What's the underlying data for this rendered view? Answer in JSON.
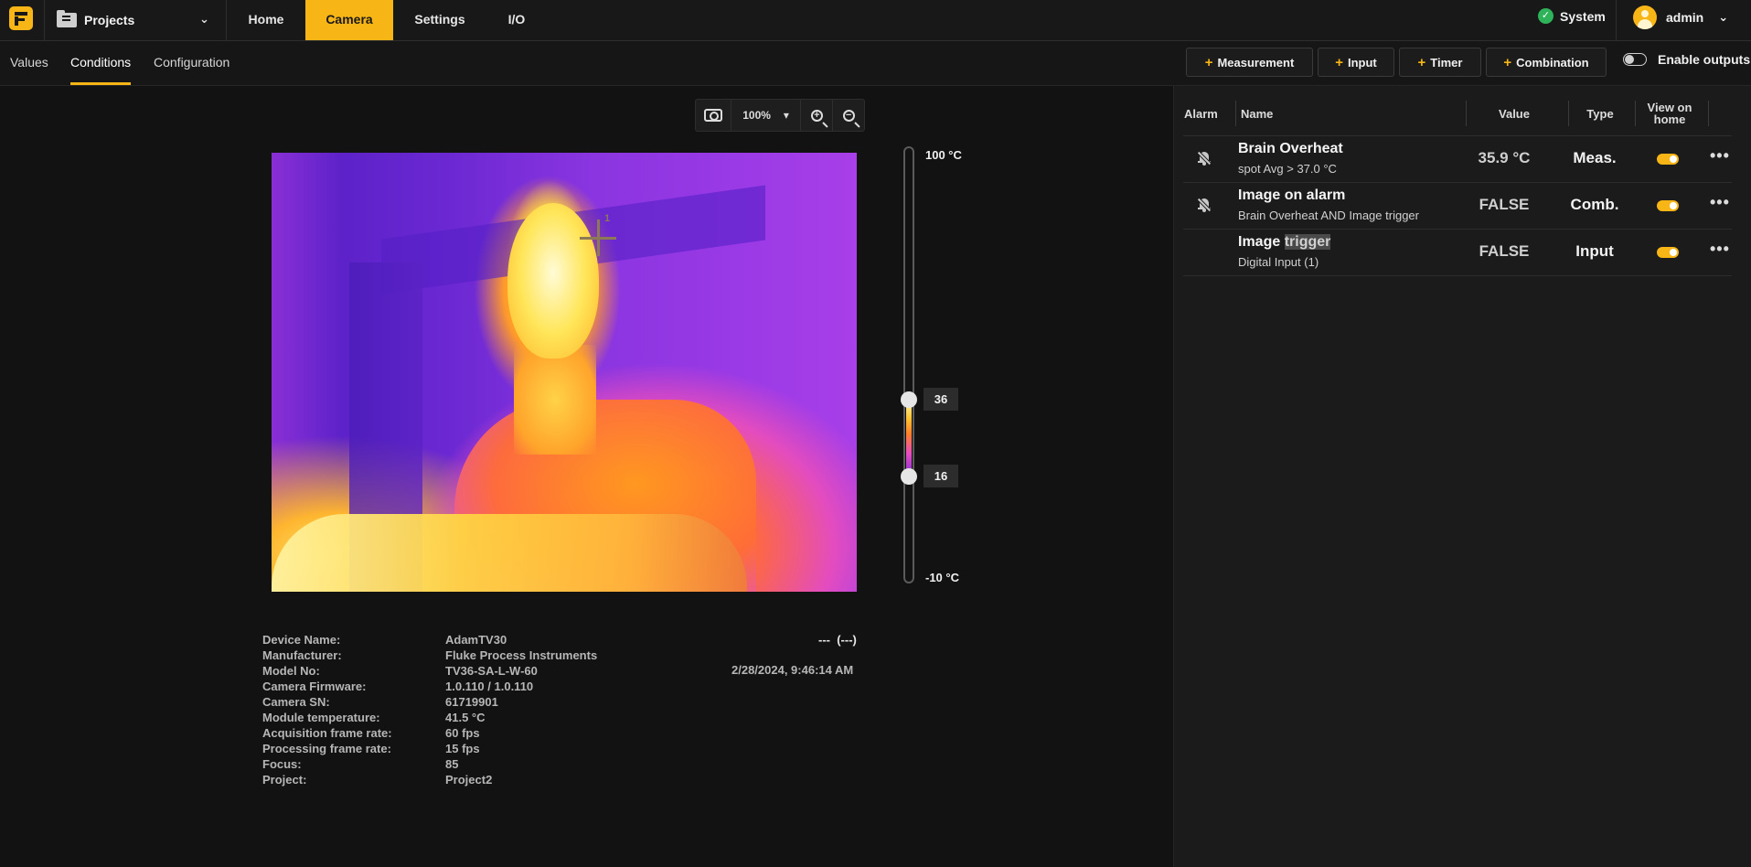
{
  "topnav": {
    "projects_label": "Projects",
    "tabs": [
      {
        "label": "Home"
      },
      {
        "label": "Camera"
      },
      {
        "label": "Settings"
      },
      {
        "label": "I/O"
      }
    ],
    "active_tab": "Camera",
    "system_label": "System",
    "user_label": "admin"
  },
  "subnav": {
    "tabs": [
      {
        "label": "Values"
      },
      {
        "label": "Conditions"
      },
      {
        "label": "Configuration"
      }
    ],
    "active_tab": "Conditions",
    "add_buttons": [
      {
        "label": "Measurement"
      },
      {
        "label": "Input"
      },
      {
        "label": "Timer"
      },
      {
        "label": "Combination"
      }
    ],
    "plus_glyph": "+",
    "enable_outputs_label": "Enable outputs",
    "enable_outputs_on": false
  },
  "toolbar": {
    "zoom_level": "100%",
    "zoom_caret": "▾",
    "icons": [
      "snapshot-camera-icon",
      "zoom-in-icon",
      "zoom-out-icon"
    ]
  },
  "thermal": {
    "crosshair_label": "1",
    "palette": "ironbow"
  },
  "scale": {
    "max_label": "100 °C",
    "min_label": "-10 °C",
    "upper_value": "36",
    "lower_value": "16"
  },
  "device_info": {
    "rows": [
      {
        "key": "Device Name:",
        "value": "AdamTV30"
      },
      {
        "key": "Manufacturer:",
        "value": "Fluke Process Instruments"
      },
      {
        "key": "Model No:",
        "value": "TV36-SA-L-W-60"
      },
      {
        "key": "Camera Firmware:",
        "value": "1.0.110 / 1.0.110"
      },
      {
        "key": "Camera SN:",
        "value": "61719901"
      },
      {
        "key": "Module temperature:",
        "value": "41.5 °C"
      },
      {
        "key": "Acquisition frame rate:",
        "value": "60 fps"
      },
      {
        "key": "Processing frame rate:",
        "value": "15 fps"
      },
      {
        "key": "Focus:",
        "value": "85"
      },
      {
        "key": "Project:",
        "value": "Project2"
      }
    ],
    "readout": "---  (---)",
    "timestamp": "2/28/2024, 9:46:14 AM"
  },
  "table": {
    "headers": {
      "alarm": "Alarm",
      "name": "Name",
      "value": "Value",
      "type": "Type",
      "view_on_home": "View on home"
    },
    "rows": [
      {
        "name": "Brain Overheat",
        "subtitle": "spot Avg > 37.0 °C",
        "value": "35.9 °C",
        "type": "Meas.",
        "alarm_icon": "bell-off-icon",
        "view_on_home": true
      },
      {
        "name": "Image on alarm",
        "subtitle": "Brain Overheat AND Image trigger",
        "value": "FALSE",
        "type": "Comb.",
        "alarm_icon": "bell-off-icon",
        "view_on_home": true
      },
      {
        "name_part1": "Image ",
        "name_part2": "trigger",
        "subtitle": "Digital Input (1)",
        "value": "FALSE",
        "type": "Input",
        "alarm_icon": "",
        "view_on_home": true
      }
    ],
    "more_glyph": "•••"
  },
  "colors": {
    "accent": "#f7b516",
    "success": "#2fb35a",
    "background": "#121212",
    "panel": "#1b1b1b"
  }
}
